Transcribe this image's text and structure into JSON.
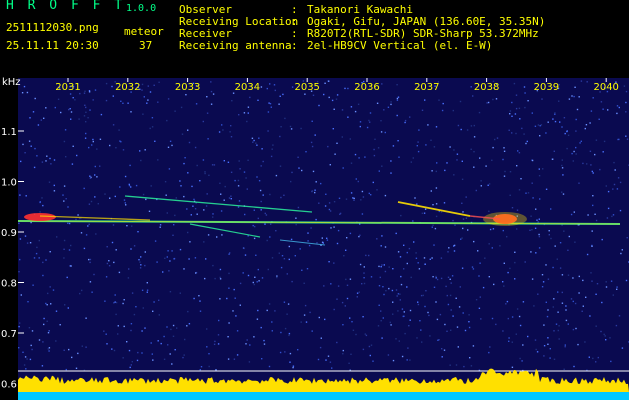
{
  "app": {
    "logo": "H R O F F T",
    "version": "1.0.0",
    "filename": "2511112030.png",
    "meteor_label": "meteor",
    "datetime": "25.11.11 20:30",
    "meteor_count": "37"
  },
  "info": [
    {
      "label": "Observer",
      "sep": ":",
      "value": "Takanori Kawachi"
    },
    {
      "label": "Receiving Location",
      "sep": ":",
      "value": "Ogaki, Gifu, JAPAN (136.60E, 35.35N)"
    },
    {
      "label": "Receiver",
      "sep": ":",
      "value": "R820T2(RTL-SDR) SDR-Sharp 53.372MHz"
    },
    {
      "label": "Receiving antenna",
      "sep": ":",
      "value": "2el-HB9CV Vertical (el. E-W)"
    }
  ],
  "spectrogram": {
    "y_unit": "kHz",
    "x_ticks": [
      "2031",
      "2032",
      "2033",
      "2034",
      "2035",
      "2036",
      "2037",
      "2038",
      "2039",
      "2040"
    ],
    "y_ticks": [
      "1.1",
      "1.0",
      "0.9",
      "0.8",
      "0.7",
      "0.6"
    ],
    "colors": {
      "background": "#0a0a50",
      "tick_text": "#ffff00",
      "trace": "#ff3030",
      "signal": "#ffe000",
      "baseline": "#00c8ff"
    }
  }
}
